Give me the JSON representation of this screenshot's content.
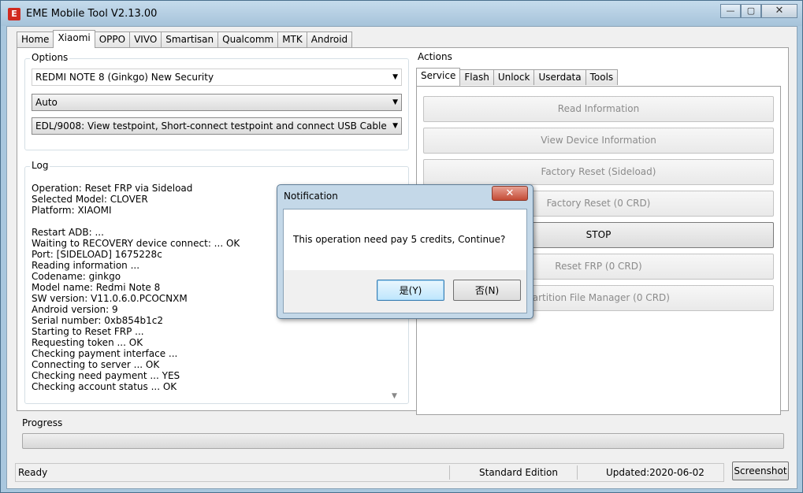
{
  "window": {
    "title": "EME Mobile Tool V2.13.00",
    "app_icon_glyph": "E",
    "minimize": "—",
    "maximize": "▢",
    "close": "✕"
  },
  "main_tabs": [
    "Home",
    "Xiaomi",
    "OPPO",
    "VIVO",
    "Smartisan",
    "Qualcomm",
    "MTK",
    "Android"
  ],
  "active_main_tab": "Xiaomi",
  "options": {
    "label": "Options",
    "model": "REDMI NOTE 8 (Ginkgo) New Security",
    "mode": "Auto",
    "connection": "EDL/9008: View testpoint, Short-connect testpoint and connect USB Cable"
  },
  "log": {
    "label": "Log",
    "lines": [
      "Operation: Reset FRP via Sideload",
      "Selected Model: CLOVER",
      "Platform: XIAOMI",
      "",
      "Restart ADB: ...",
      "Waiting to RECOVERY device connect: ... OK",
      "Port: [SIDELOAD] 1675228c",
      "Reading information ...",
      "Codename: ginkgo",
      "Model name: Redmi Note 8",
      "SW version: V11.0.6.0.PCOCNXM",
      "Android version: 9",
      "Serial number: 0xb854b1c2",
      "Starting to Reset FRP ...",
      "Requesting token ... OK",
      "Checking payment interface ...",
      "Connecting to server ... OK",
      "Checking need payment ... YES",
      "Checking account status ... OK"
    ]
  },
  "actions": {
    "label": "Actions",
    "tabs": [
      "Service",
      "Flash",
      "Unlock",
      "Userdata",
      "Tools"
    ],
    "active_tab": "Service",
    "buttons": [
      {
        "label": "Read Information",
        "enabled": false
      },
      {
        "label": "View Device Information",
        "enabled": false
      },
      {
        "label": "Factory Reset (Sideload)",
        "enabled": false
      },
      {
        "label": "Factory Reset (0 CRD)",
        "enabled": false
      },
      {
        "label": "STOP",
        "enabled": true
      },
      {
        "label": "Reset FRP (0 CRD)",
        "enabled": false
      },
      {
        "label": "Partition File Manager (0 CRD)",
        "enabled": false
      }
    ]
  },
  "progress": {
    "label": "Progress",
    "value": 0
  },
  "status": {
    "state": "Ready",
    "edition": "Standard Edition",
    "updated": "Updated:2020-06-02",
    "screenshot_button": "Screenshot"
  },
  "dialog": {
    "title": "Notification",
    "close": "✕",
    "message": "This operation need pay 5 credits, Continue?",
    "yes": "是(Y)",
    "no": "否(N)"
  },
  "icons": {
    "dropdown": "▼",
    "scroll_up": "▲",
    "scroll_down": "▼"
  }
}
